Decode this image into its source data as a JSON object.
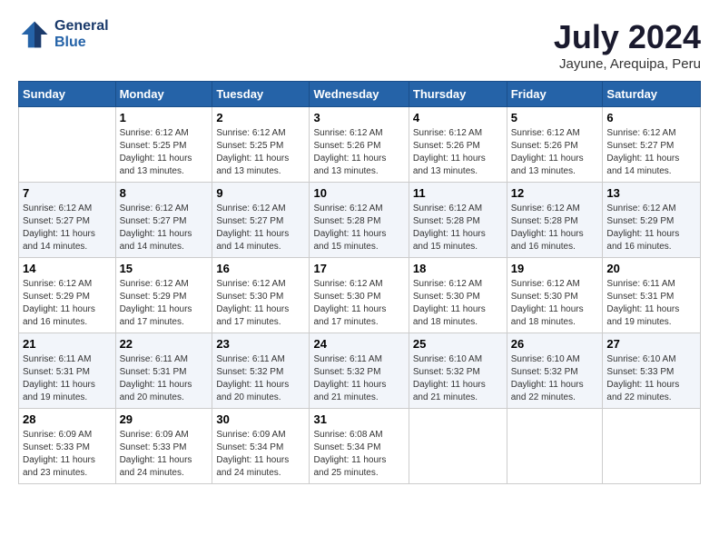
{
  "header": {
    "logo_line1": "General",
    "logo_line2": "Blue",
    "month_title": "July 2024",
    "location": "Jayune, Arequipa, Peru"
  },
  "weekdays": [
    "Sunday",
    "Monday",
    "Tuesday",
    "Wednesday",
    "Thursday",
    "Friday",
    "Saturday"
  ],
  "weeks": [
    [
      {
        "day": "",
        "detail": ""
      },
      {
        "day": "1",
        "detail": "Sunrise: 6:12 AM\nSunset: 5:25 PM\nDaylight: 11 hours\nand 13 minutes."
      },
      {
        "day": "2",
        "detail": "Sunrise: 6:12 AM\nSunset: 5:25 PM\nDaylight: 11 hours\nand 13 minutes."
      },
      {
        "day": "3",
        "detail": "Sunrise: 6:12 AM\nSunset: 5:26 PM\nDaylight: 11 hours\nand 13 minutes."
      },
      {
        "day": "4",
        "detail": "Sunrise: 6:12 AM\nSunset: 5:26 PM\nDaylight: 11 hours\nand 13 minutes."
      },
      {
        "day": "5",
        "detail": "Sunrise: 6:12 AM\nSunset: 5:26 PM\nDaylight: 11 hours\nand 13 minutes."
      },
      {
        "day": "6",
        "detail": "Sunrise: 6:12 AM\nSunset: 5:27 PM\nDaylight: 11 hours\nand 14 minutes."
      }
    ],
    [
      {
        "day": "7",
        "detail": "Sunrise: 6:12 AM\nSunset: 5:27 PM\nDaylight: 11 hours\nand 14 minutes."
      },
      {
        "day": "8",
        "detail": "Sunrise: 6:12 AM\nSunset: 5:27 PM\nDaylight: 11 hours\nand 14 minutes."
      },
      {
        "day": "9",
        "detail": "Sunrise: 6:12 AM\nSunset: 5:27 PM\nDaylight: 11 hours\nand 14 minutes."
      },
      {
        "day": "10",
        "detail": "Sunrise: 6:12 AM\nSunset: 5:28 PM\nDaylight: 11 hours\nand 15 minutes."
      },
      {
        "day": "11",
        "detail": "Sunrise: 6:12 AM\nSunset: 5:28 PM\nDaylight: 11 hours\nand 15 minutes."
      },
      {
        "day": "12",
        "detail": "Sunrise: 6:12 AM\nSunset: 5:28 PM\nDaylight: 11 hours\nand 16 minutes."
      },
      {
        "day": "13",
        "detail": "Sunrise: 6:12 AM\nSunset: 5:29 PM\nDaylight: 11 hours\nand 16 minutes."
      }
    ],
    [
      {
        "day": "14",
        "detail": "Sunrise: 6:12 AM\nSunset: 5:29 PM\nDaylight: 11 hours\nand 16 minutes."
      },
      {
        "day": "15",
        "detail": "Sunrise: 6:12 AM\nSunset: 5:29 PM\nDaylight: 11 hours\nand 17 minutes."
      },
      {
        "day": "16",
        "detail": "Sunrise: 6:12 AM\nSunset: 5:30 PM\nDaylight: 11 hours\nand 17 minutes."
      },
      {
        "day": "17",
        "detail": "Sunrise: 6:12 AM\nSunset: 5:30 PM\nDaylight: 11 hours\nand 17 minutes."
      },
      {
        "day": "18",
        "detail": "Sunrise: 6:12 AM\nSunset: 5:30 PM\nDaylight: 11 hours\nand 18 minutes."
      },
      {
        "day": "19",
        "detail": "Sunrise: 6:12 AM\nSunset: 5:30 PM\nDaylight: 11 hours\nand 18 minutes."
      },
      {
        "day": "20",
        "detail": "Sunrise: 6:11 AM\nSunset: 5:31 PM\nDaylight: 11 hours\nand 19 minutes."
      }
    ],
    [
      {
        "day": "21",
        "detail": "Sunrise: 6:11 AM\nSunset: 5:31 PM\nDaylight: 11 hours\nand 19 minutes."
      },
      {
        "day": "22",
        "detail": "Sunrise: 6:11 AM\nSunset: 5:31 PM\nDaylight: 11 hours\nand 20 minutes."
      },
      {
        "day": "23",
        "detail": "Sunrise: 6:11 AM\nSunset: 5:32 PM\nDaylight: 11 hours\nand 20 minutes."
      },
      {
        "day": "24",
        "detail": "Sunrise: 6:11 AM\nSunset: 5:32 PM\nDaylight: 11 hours\nand 21 minutes."
      },
      {
        "day": "25",
        "detail": "Sunrise: 6:10 AM\nSunset: 5:32 PM\nDaylight: 11 hours\nand 21 minutes."
      },
      {
        "day": "26",
        "detail": "Sunrise: 6:10 AM\nSunset: 5:32 PM\nDaylight: 11 hours\nand 22 minutes."
      },
      {
        "day": "27",
        "detail": "Sunrise: 6:10 AM\nSunset: 5:33 PM\nDaylight: 11 hours\nand 22 minutes."
      }
    ],
    [
      {
        "day": "28",
        "detail": "Sunrise: 6:09 AM\nSunset: 5:33 PM\nDaylight: 11 hours\nand 23 minutes."
      },
      {
        "day": "29",
        "detail": "Sunrise: 6:09 AM\nSunset: 5:33 PM\nDaylight: 11 hours\nand 24 minutes."
      },
      {
        "day": "30",
        "detail": "Sunrise: 6:09 AM\nSunset: 5:34 PM\nDaylight: 11 hours\nand 24 minutes."
      },
      {
        "day": "31",
        "detail": "Sunrise: 6:08 AM\nSunset: 5:34 PM\nDaylight: 11 hours\nand 25 minutes."
      },
      {
        "day": "",
        "detail": ""
      },
      {
        "day": "",
        "detail": ""
      },
      {
        "day": "",
        "detail": ""
      }
    ]
  ]
}
